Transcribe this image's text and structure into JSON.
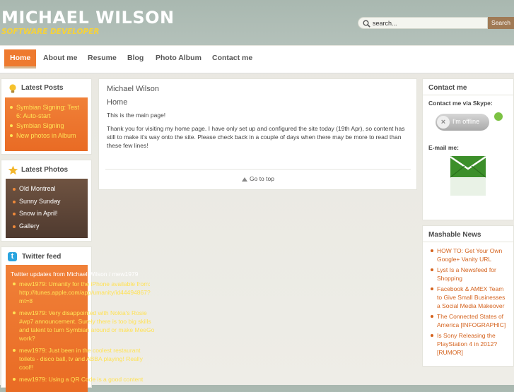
{
  "header": {
    "title": "MICHAEL WILSON",
    "subtitle": "SOFTWARE DEVELOPER"
  },
  "search": {
    "placeholder": "search...",
    "button": "Search"
  },
  "nav": {
    "items": [
      "Home",
      "About me",
      "Resume",
      "Blog",
      "Photo Album",
      "Contact me"
    ]
  },
  "latest_posts": {
    "title": "Latest Posts",
    "items": [
      "Symbian Signing: Test 6: Auto-start",
      "Symbian Signing",
      "New photos in Album"
    ]
  },
  "latest_photos": {
    "title": "Latest Photos",
    "items": [
      "Old Montreal",
      "Sunny Sunday",
      "Snow in April!",
      "Gallery"
    ]
  },
  "twitter": {
    "title": "Twitter feed",
    "intro": "Twitter updates from Michael Wilson / mew1979",
    "items": [
      "mew1979: Umanity for the iPhone available from: http://itunes.apple.com/app/umanity/id44494867?mt=8",
      "mew1979: Very disappointed with Nokia's Rosie #wp7 announcement. Surely there is too big skills and talent to turn Symbian around or make MeeGo work?",
      "mew1979: Just been in the coolest restaurant toilets - disco ball, tv and ABBA playing! Really cool!!",
      "mew1979: Using a QR Code is a good content"
    ]
  },
  "main": {
    "site_name": "Michael Wilson",
    "heading": "Home",
    "paragraph1": "This is the main page!",
    "paragraph2": "Thank you for visiting my home page. I have only set up and configured the site today (19th Apr), so content has still to make it's way onto the site. Please check back in a couple of days when there may be more to read than these few lines!",
    "go_to_top": "Go to top"
  },
  "contact": {
    "title": "Contact me",
    "skype_label": "Contact me via Skype:",
    "skype_status": "I'm offline",
    "email_label": "E-mail me:"
  },
  "mashable": {
    "title": "Mashable News",
    "items": [
      "HOW TO: Get Your Own Google+ Vanity URL",
      "Lyst Is a Newsfeed for Shopping",
      "Facebook & AMEX Team to Give Small Businesses a Social Media Makeover",
      "The Connected States of America [INFOGRAPHIC]",
      "Is Sony Releasing the PlayStation 4 in 2012? [RUMOR]"
    ]
  },
  "colors": {
    "accent": "#ee7a2f",
    "link": "#d4621d",
    "yellow": "#ffe255",
    "brown": "#5f4537",
    "header_bg": "#b4c1ba"
  }
}
